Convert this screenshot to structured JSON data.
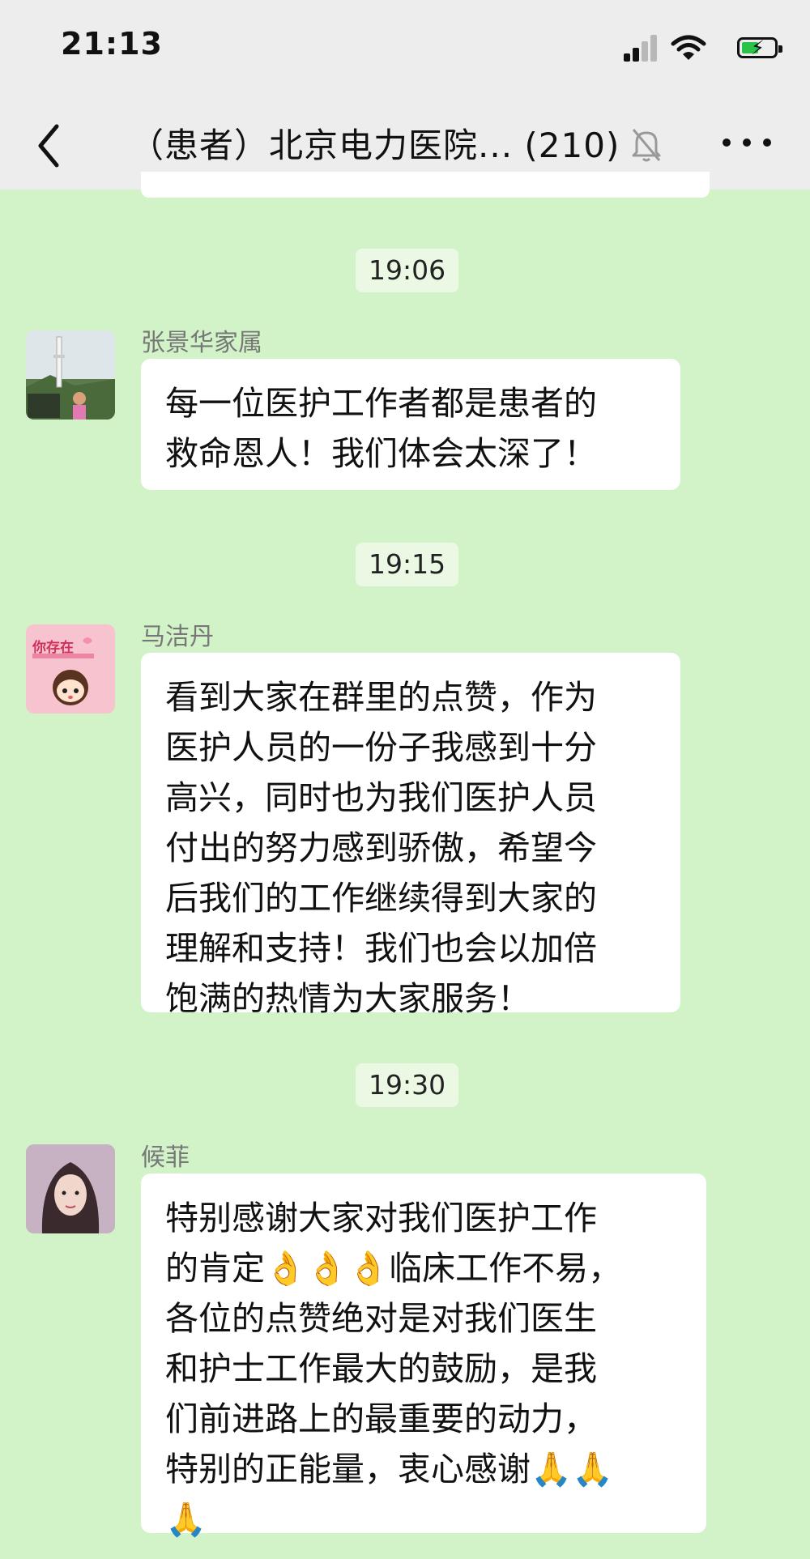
{
  "status_bar": {
    "time": "21:13"
  },
  "header": {
    "title": "（患者）北京电力医院... (210)"
  },
  "messages": [
    {
      "time": "19:06",
      "sender": "张景华家属",
      "lines": [
        "每一位医护工作者都是患者的",
        "救命恩人！我们体会太深了！"
      ]
    },
    {
      "time": "19:15",
      "sender": "马洁丹",
      "avatar_text": "你存在",
      "lines": [
        "看到大家在群里的点赞，作为",
        "医护人员的一份子我感到十分",
        "高兴，同时也为我们医护人员",
        "付出的努力感到骄傲，希望今",
        "后我们的工作继续得到大家的",
        "理解和支持！我们也会以加倍",
        "饱满的热情为大家服务！"
      ]
    },
    {
      "time": "19:30",
      "sender": "候菲",
      "lines": [
        "特别感谢大家对我们医护工作",
        "的肯定👌👌👌临床工作不易，",
        "各位的点赞绝对是对我们医生",
        "和护士工作最大的鼓励，是我",
        "们前进路上的最重要的动力，",
        "特别的正能量，衷心感谢🙏🙏",
        "🙏"
      ]
    }
  ],
  "icons": {
    "back": "chevron-left-icon",
    "mute": "muted-bell-icon",
    "more": "more-dots-icon",
    "signal": "cellular-signal-icon",
    "wifi": "wifi-icon",
    "battery": "battery-charging-icon"
  },
  "colors": {
    "chat_background": "#d2f3c8",
    "bubble": "#ffffff",
    "time_pill": "#eaf8e4",
    "topbar": "#ededed"
  }
}
